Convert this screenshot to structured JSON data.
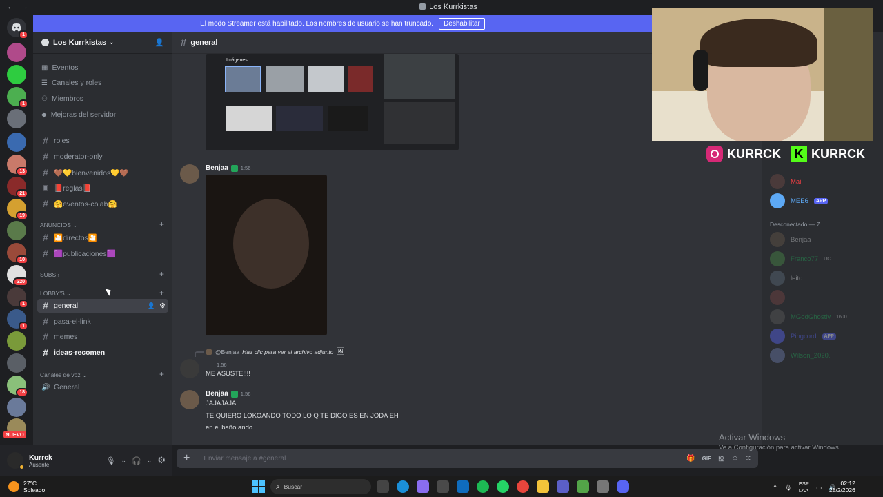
{
  "window": {
    "title": "Los Kurrkistas"
  },
  "banner": {
    "text": "El modo Streamer está habilitado. Los nombres de usuario se han truncado.",
    "button": "Deshabilitar"
  },
  "guilds": {
    "badges": [
      "1",
      "1",
      "13",
      "21",
      "19",
      "10",
      "320",
      "1",
      "1",
      "18",
      "NUEVO"
    ]
  },
  "server": {
    "name": "Los Kurrkistas"
  },
  "sidebar": {
    "top_items": [
      "Eventos",
      "Canales y roles",
      "Miembros",
      "Mejoras del servidor"
    ],
    "channels": [
      "roles",
      "moderator-only",
      "🤎💛bienvenidos💛🤎",
      "📕reglas📕",
      "🤗eventos-colab🤗"
    ],
    "cat_anuncios": "ANUNCIOS",
    "anuncios": [
      "🎦directos🎦",
      "🟪publicaciones🟪"
    ],
    "cat_subs": "SUBS",
    "cat_lobby": "LOBBY'S",
    "lobby": [
      "general",
      "pasa-el-link",
      "memes",
      "ideas-recomen"
    ],
    "cat_voz": "Canales de voz",
    "voice": [
      "General"
    ]
  },
  "user": {
    "name": "Kurrck",
    "status": "Ausente"
  },
  "channel": {
    "name": "general"
  },
  "screenshot_embed": {
    "label": "Imágenes"
  },
  "messages": [
    {
      "author": "Benjaa",
      "time": "1:56"
    },
    {
      "reply_to": "@Benjaa",
      "reply_text": "Haz clic para ver el archivo adjunto",
      "time": "1:56",
      "text": "ME ASUSTE!!!!"
    },
    {
      "author": "Benjaa",
      "time": "1:56",
      "lines": [
        "JAJAJAJA",
        "TE QUIERO LOKOANDO TODO LO Q TE DIGO ES EN JODA EH",
        "en el baño ando"
      ]
    }
  ],
  "composer": {
    "placeholder": "Enviar mensaje a #general"
  },
  "members": {
    "online": [
      {
        "name": "Mai",
        "color": "#f23f43"
      },
      {
        "name": "MEE6",
        "badge": "APP",
        "color": "#5da9f5"
      }
    ],
    "offline_header": "Desconectado — 7",
    "offline": [
      {
        "name": "Benjaa",
        "extra": ""
      },
      {
        "name": "Franco77",
        "extra": "UC"
      },
      {
        "name": "leito",
        "extra": ""
      },
      {
        "name": "",
        "extra": ""
      },
      {
        "name": "MGodGhostly",
        "extra": "1600"
      },
      {
        "name": "Pingcord",
        "extra": "APP"
      },
      {
        "name": "Wilson_2020.",
        "extra": ""
      }
    ]
  },
  "webcam": {
    "instagram": "KURRCK",
    "kick": "KURRCK"
  },
  "activation": {
    "title": "Activar Windows",
    "sub": "Ve a Configuración para activar Windows."
  },
  "taskbar": {
    "weather_temp": "27°C",
    "weather_desc": "Soleado",
    "search": "Buscar",
    "lang": "ESP",
    "lang2": "LAA",
    "time": "02:12",
    "date": "28/2/2026"
  },
  "colors": {
    "accent": "#5865f2",
    "online": "#23a55a",
    "mention": "#f23f43"
  }
}
